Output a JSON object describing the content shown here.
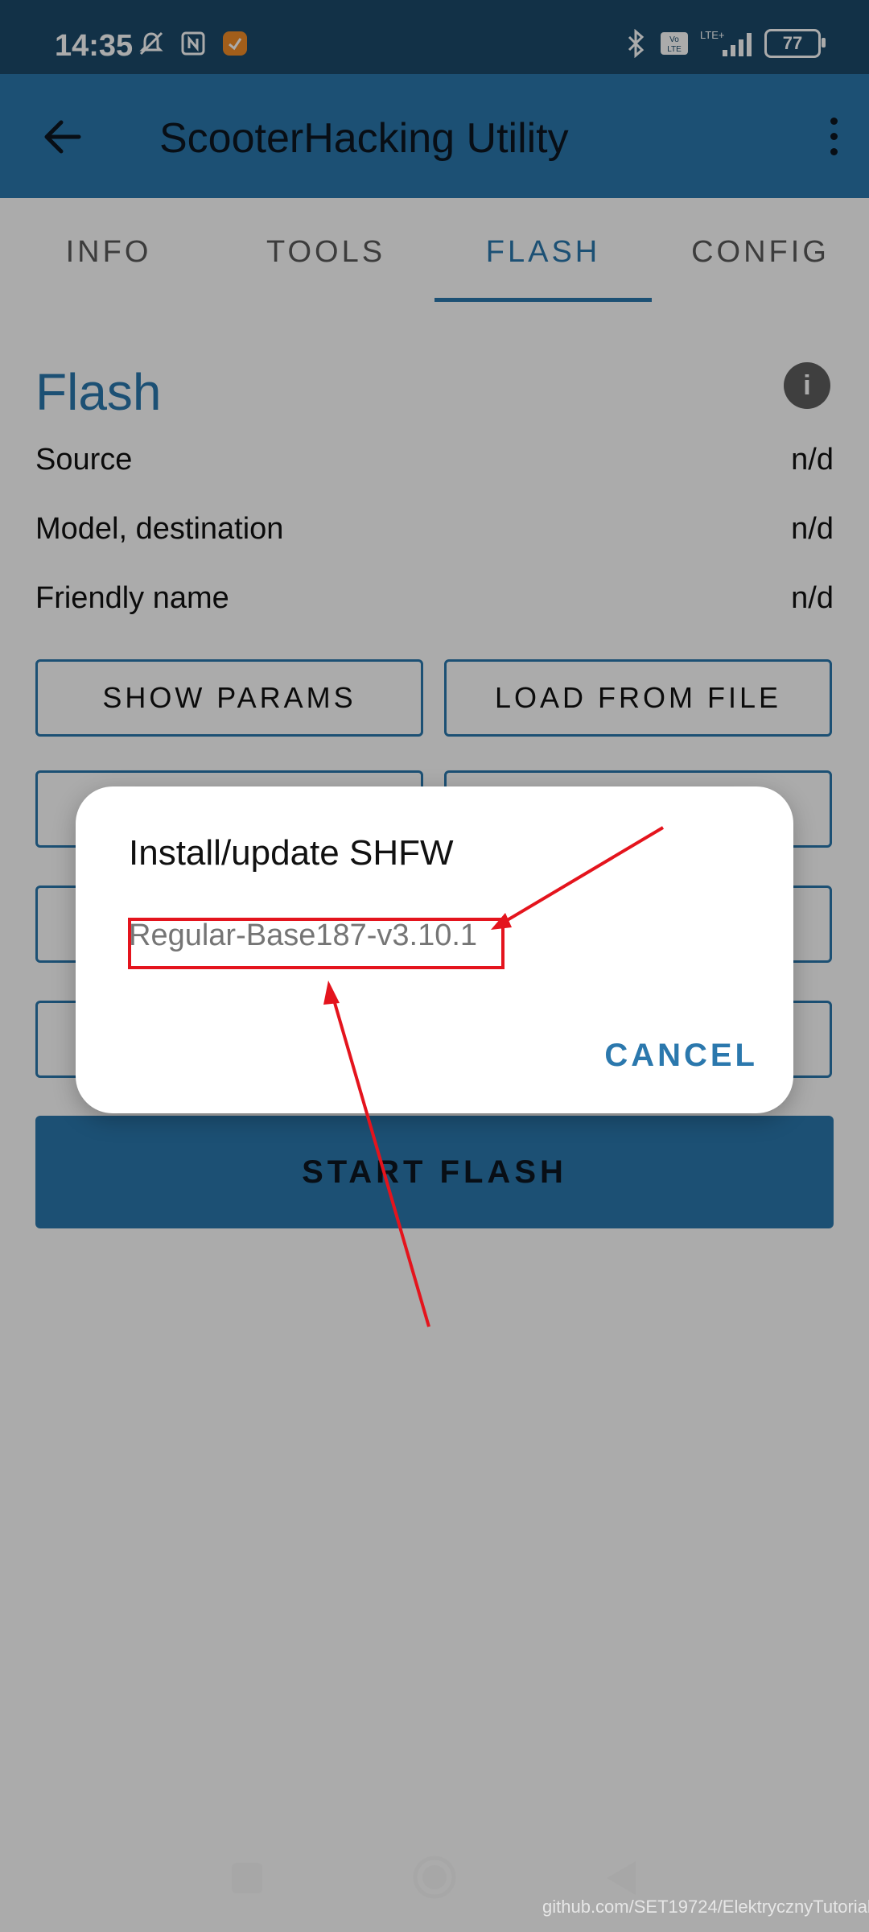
{
  "status": {
    "time": "14:35",
    "battery": "77",
    "left_icons": [
      "silent-icon",
      "nfc-icon",
      "app-notification-icon"
    ],
    "right_icons": [
      "bluetooth-icon",
      "volte-icon",
      "lte-signal-icon",
      "battery-icon"
    ]
  },
  "app_bar": {
    "title": "ScooterHacking Utility",
    "back_icon": "arrow-back-icon",
    "overflow_icon": "more-vert-icon"
  },
  "tabs": [
    {
      "label": "INFO"
    },
    {
      "label": "TOOLS"
    },
    {
      "label": "FLASH",
      "active": true
    },
    {
      "label": "CONFIG"
    }
  ],
  "flash": {
    "title": "Flash",
    "info_icon": "info-icon",
    "rows": [
      {
        "label": "Source",
        "value": "n/d"
      },
      {
        "label": "Model, destination",
        "value": "n/d"
      },
      {
        "label": "Friendly name",
        "value": "n/d"
      }
    ],
    "buttons": {
      "show_params": "SHOW PARAMS",
      "load_from_file": "LOAD FROM FILE"
    },
    "start_flash": "START FLASH"
  },
  "dialog": {
    "title": "Install/update SHFW",
    "option": "Regular-Base187-v3.10.1",
    "cancel": "CANCEL"
  },
  "colors": {
    "primary": "#2b78ad",
    "status_bar": "#1b4a6b",
    "annotation_red": "#e4141d"
  },
  "watermark": "github.com/SET19724/ElektrycznyTutorial"
}
